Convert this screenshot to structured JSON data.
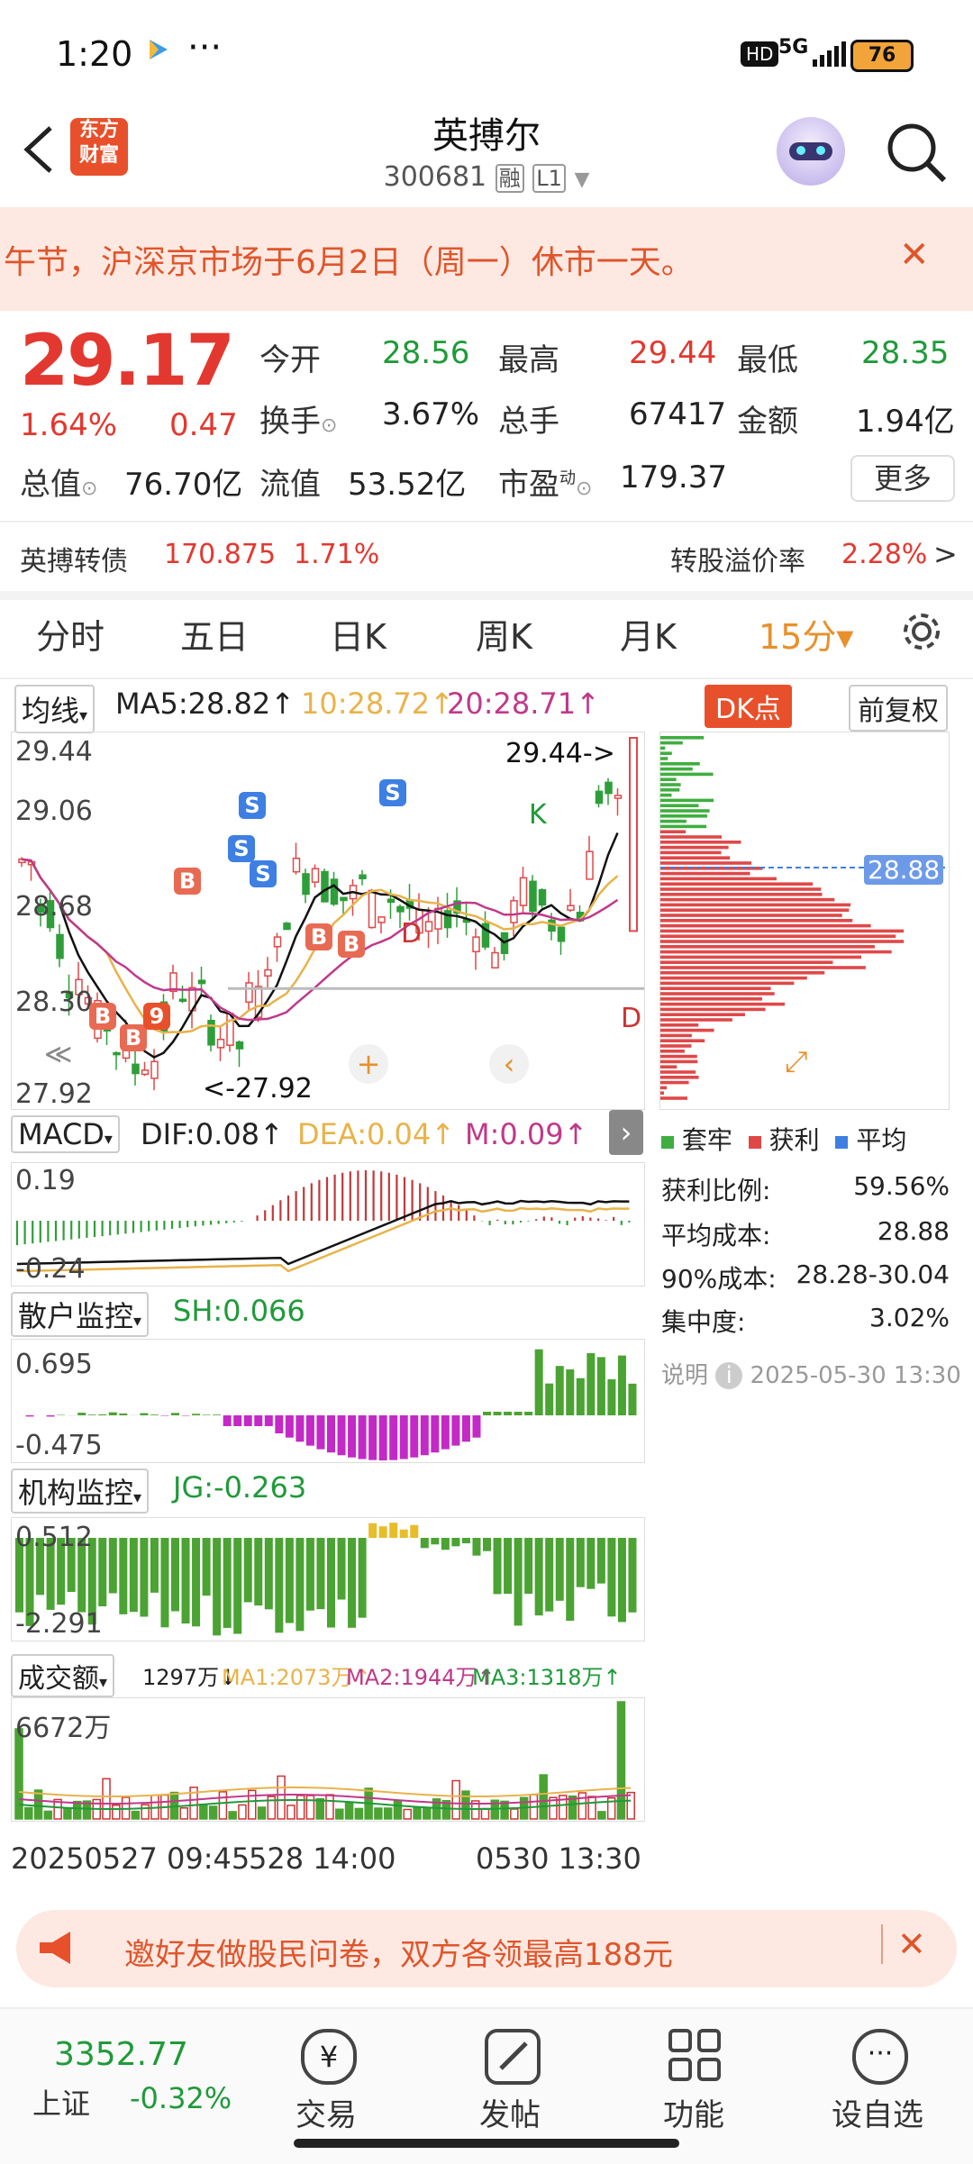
{
  "status_bar": {
    "time": "1:20",
    "more": "···",
    "hd": "HD",
    "network": "5G",
    "battery": "76"
  },
  "header": {
    "back_icon": "chevron-left-icon",
    "logo_text": "东方\n财富",
    "title": "英搏尔",
    "code": "300681",
    "tag_rong": "融",
    "tag_level": "L1",
    "robot_icon": "robot-avatar-icon",
    "search_icon": "search-icon"
  },
  "notice": {
    "text": "午节，沪深京市场于6月2日（周一）休市一天。",
    "close": "✕"
  },
  "quote": {
    "price": "29.17",
    "pct": "1.64%",
    "change": "0.47",
    "open_label": "今开",
    "open": "28.56",
    "high_label": "最高",
    "high": "29.44",
    "low_label": "最低",
    "low": "28.35",
    "turnover_label": "换手",
    "turnover": "3.67%",
    "volume_label": "总手",
    "volume": "67417",
    "amount_label": "金额",
    "amount": "1.94亿",
    "mktcap_label": "总值",
    "mktcap": "76.70亿",
    "float_label": "流值",
    "float": "53.52亿",
    "pe_label": "市盈",
    "pe_sup": "动",
    "pe": "179.37",
    "more": "更多"
  },
  "bond": {
    "name": "英搏转债",
    "price": "170.875",
    "pct": "1.71%",
    "premium_label": "转股溢价率",
    "premium": "2.28%",
    "arrow": ">"
  },
  "tabs": [
    "分时",
    "五日",
    "日K",
    "周K",
    "月K",
    "15分▾"
  ],
  "settings_icon": "gear-icon",
  "kline": {
    "ma_select": "均线",
    "ma5": "MA5:28.82↑",
    "ma10": "10:28.72↑",
    "ma20": "20:28.71↑",
    "dk": "DK点",
    "fq": "前复权",
    "ymax": "29.44",
    "y2": "29.06",
    "y3": "28.68",
    "y4": "28.30",
    "ymin": "27.92",
    "high_tag": "29.44->",
    "low_tag": "<-27.92",
    "price_line": "28.88",
    "signals": {
      "s": "S",
      "b": "B",
      "k": "K",
      "d": "D",
      "nine": "9"
    }
  },
  "macd": {
    "select": "MACD",
    "dif": "DIF:0.08↑",
    "dea": "DEA:0.04↑",
    "m": "M:0.09↑",
    "ymax": "0.19",
    "ymin": "-0.24"
  },
  "chip": {
    "legend": [
      {
        "label": "套牢",
        "color": "#3fae3f"
      },
      {
        "label": "获利",
        "color": "#e04848"
      },
      {
        "label": "平均",
        "color": "#3d7fe3"
      }
    ],
    "profit_label": "获利比例:",
    "profit": "59.56%",
    "avg_label": "平均成本:",
    "avg": "28.88",
    "c90_label": "90%成本:",
    "c90": "28.28-30.04",
    "conc_label": "集中度:",
    "conc": "3.02%",
    "note_label": "说明",
    "note_time": "2025-05-30 13:30"
  },
  "retail": {
    "select": "散户监控",
    "sh": "SH:0.066",
    "ymax": "0.695",
    "ymin": "-0.475"
  },
  "inst": {
    "select": "机构监控",
    "jg": "JG:-0.263",
    "ymax": "0.512",
    "ymin": "-2.291"
  },
  "vol": {
    "select": "成交额",
    "v": "1297万↓",
    "ma1": "MA1:2073万↑",
    "ma2": "MA2:1944万↑",
    "ma3": "MA3:1318万↑",
    "ymax": "6672万"
  },
  "xaxis": {
    "t1": "20250527 09:45",
    "t2": "528 14:00",
    "t3": "0530 13:30"
  },
  "ad": {
    "text": "邀好友做股民问卷，双方各领最高188元",
    "close": "✕"
  },
  "tabbar": {
    "index_value": "3352.77",
    "index_name": "上证",
    "index_pct": "-0.32%",
    "items": [
      {
        "label": "交易",
        "icon": "yen-icon"
      },
      {
        "label": "发帖",
        "icon": "edit-icon"
      },
      {
        "label": "功能",
        "icon": "grid-icon"
      },
      {
        "label": "设自选",
        "icon": "more-icon"
      }
    ]
  }
}
